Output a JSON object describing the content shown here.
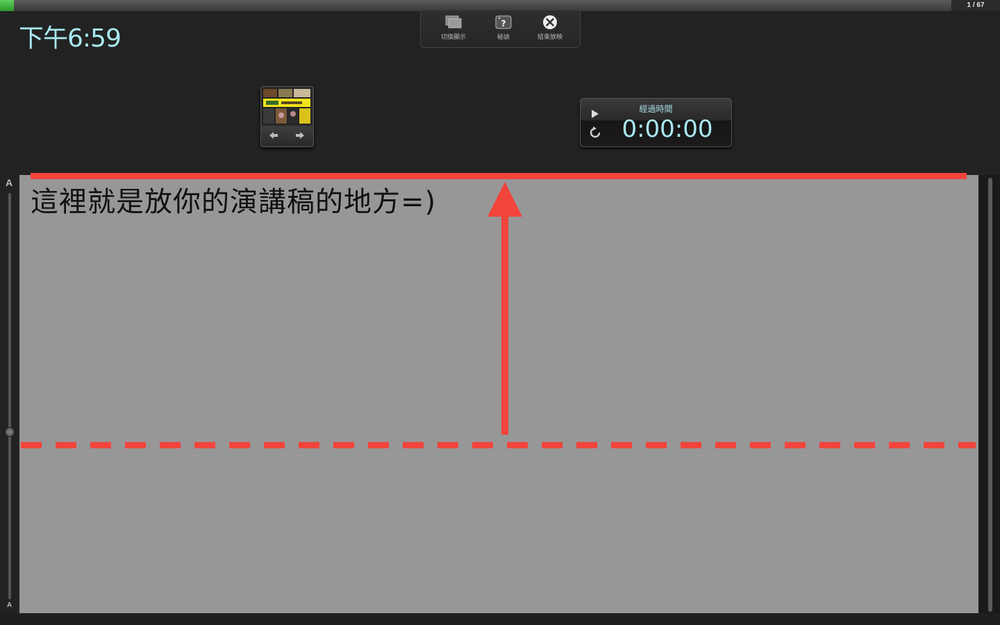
{
  "presenter": {
    "clock": "下午6:59",
    "slide_counter": "1 / 67"
  },
  "toolbar": {
    "switch_display_label": "切換顯示",
    "help_label": "秘訣",
    "end_show_label": "結束放映"
  },
  "timer": {
    "label": "經過時間",
    "value": "0:00:00"
  },
  "notes": {
    "text": "這裡就是放你的演講稿的地方=)",
    "size_large_label": "A",
    "size_small_label": "A"
  },
  "colors": {
    "annotation": "#f2443b",
    "notes_background": "#979797",
    "clock_text": "#a9e9f2"
  },
  "icons": [
    "switch-display-icon",
    "help-icon",
    "close-icon",
    "play-icon",
    "reset-icon",
    "arrow-left-icon",
    "arrow-right-icon"
  ]
}
